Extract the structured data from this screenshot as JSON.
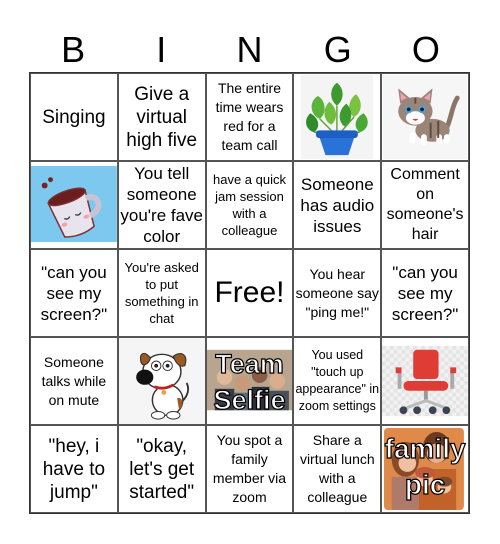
{
  "header": {
    "letters": [
      "B",
      "I",
      "N",
      "G",
      "O"
    ]
  },
  "cells": [
    {
      "text": "Singing"
    },
    {
      "text": "Give a virtual high five"
    },
    {
      "text": "The entire time wears red for a team call"
    },
    {
      "image": "potted-plant",
      "text": ""
    },
    {
      "image": "kitten",
      "text": ""
    },
    {
      "image": "coffee-mug",
      "text": ""
    },
    {
      "text": "You tell someone you're fave color"
    },
    {
      "text": "have a quick jam session with a colleague"
    },
    {
      "text": "Someone has audio issues"
    },
    {
      "text": "Comment on someone's hair"
    },
    {
      "text": "\"can you see my screen?\""
    },
    {
      "text": "You're asked to put something in chat"
    },
    {
      "text": "Free!"
    },
    {
      "text": "You hear someone say \"ping me!\""
    },
    {
      "text": "\"can you see my screen?\""
    },
    {
      "text": "Someone talks while on mute"
    },
    {
      "image": "dog",
      "text": ""
    },
    {
      "image": "team-selfie-photo",
      "line1": "Team",
      "line2": "Selfie"
    },
    {
      "text": "You used \"touch up appearance\" in zoom settings"
    },
    {
      "image": "office-chair",
      "text": ""
    },
    {
      "text": "\"hey, i have to jump\""
    },
    {
      "text": "\"okay, let's get started\""
    },
    {
      "text": "You spot a family member via zoom"
    },
    {
      "text": "Share a virtual lunch with a colleague"
    },
    {
      "image": "family-photo",
      "line1": "family",
      "line2": "pic"
    }
  ]
}
